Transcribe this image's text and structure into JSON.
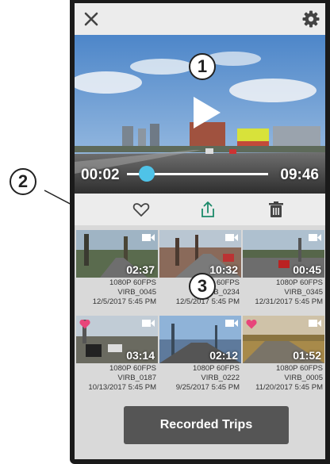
{
  "player": {
    "current_time": "00:02",
    "total_time": "09:46",
    "progress": 0.06
  },
  "icons": {
    "close": "close-icon",
    "settings": "gear-icon",
    "play": "play-icon",
    "favorite": "heart-icon",
    "share": "share-icon",
    "delete": "trash-icon"
  },
  "callouts": [
    "1",
    "2",
    "3"
  ],
  "videos": [
    {
      "duration": "02:37",
      "quality": "1080P 60FPS",
      "name": "VIRB_0045",
      "date": "12/5/2017 5:45 PM",
      "favorite": false
    },
    {
      "duration": "10:32",
      "quality": "1080P 60FPS",
      "name": "VIRB_0234",
      "date": "12/5/2017 5:45 PM",
      "favorite": false
    },
    {
      "duration": "00:45",
      "quality": "1080P 60FPS",
      "name": "VIRB_0345",
      "date": "12/31/2017 5:45 PM",
      "favorite": false
    },
    {
      "duration": "03:14",
      "quality": "1080P 60FPS",
      "name": "VIRB_0187",
      "date": "10/13/2017 5:45 PM",
      "favorite": true
    },
    {
      "duration": "02:12",
      "quality": "1080P 60FPS",
      "name": "VIRB_0222",
      "date": "9/25/2017 5:45 PM",
      "favorite": false
    },
    {
      "duration": "01:52",
      "quality": "1080P 60FPS",
      "name": "VIRB_0005",
      "date": "11/20/2017 5:45 PM",
      "favorite": true
    }
  ],
  "recorded_trips_label": "Recorded Trips",
  "colors": {
    "progress_accent": "#4fc3e8",
    "button_bg": "#555555",
    "favorite_heart": "#e8457a"
  }
}
